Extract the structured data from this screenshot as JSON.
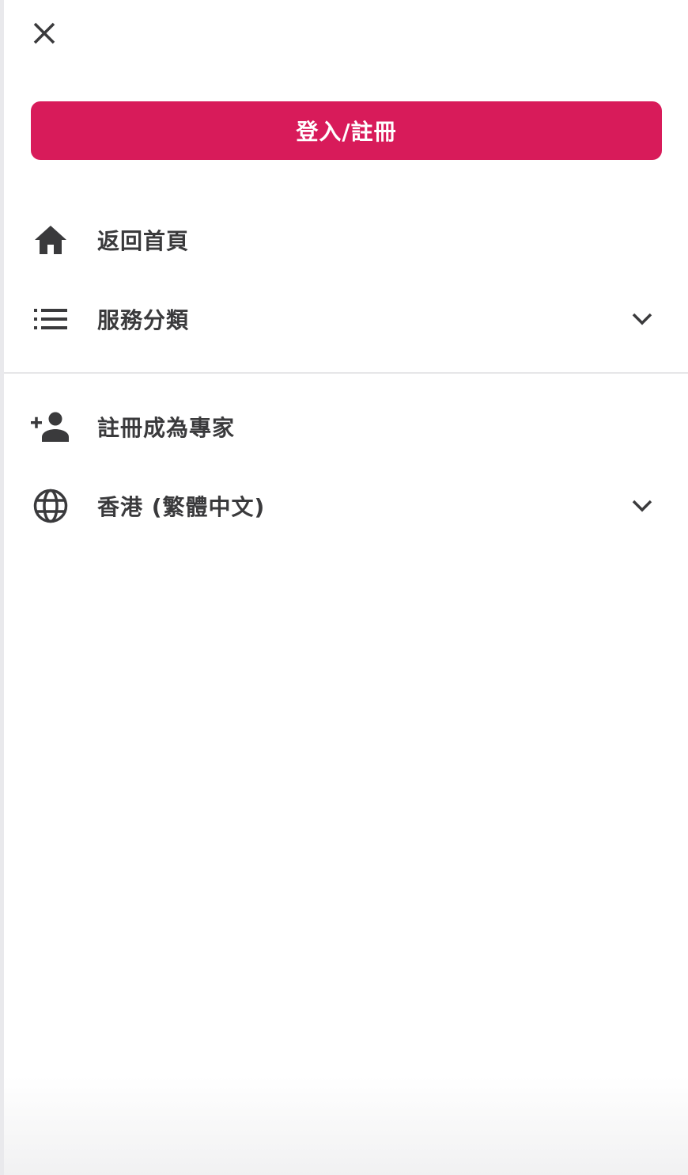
{
  "colors": {
    "accent": "#d81b5a",
    "icon": "#3a3a3c",
    "text": "#3a3a3c"
  },
  "header": {
    "close_icon": "close-icon"
  },
  "login_button": {
    "label": "登入/註冊"
  },
  "menu": {
    "home": {
      "label": "返回首頁",
      "icon": "home-icon"
    },
    "categories": {
      "label": "服務分類",
      "icon": "list-icon",
      "expand_icon": "chevron-down-icon"
    },
    "become_expert": {
      "label": "註冊成為專家",
      "icon": "add-person-icon"
    },
    "language": {
      "label": "香港 (繁體中文)",
      "icon": "globe-icon",
      "expand_icon": "chevron-down-icon"
    }
  }
}
